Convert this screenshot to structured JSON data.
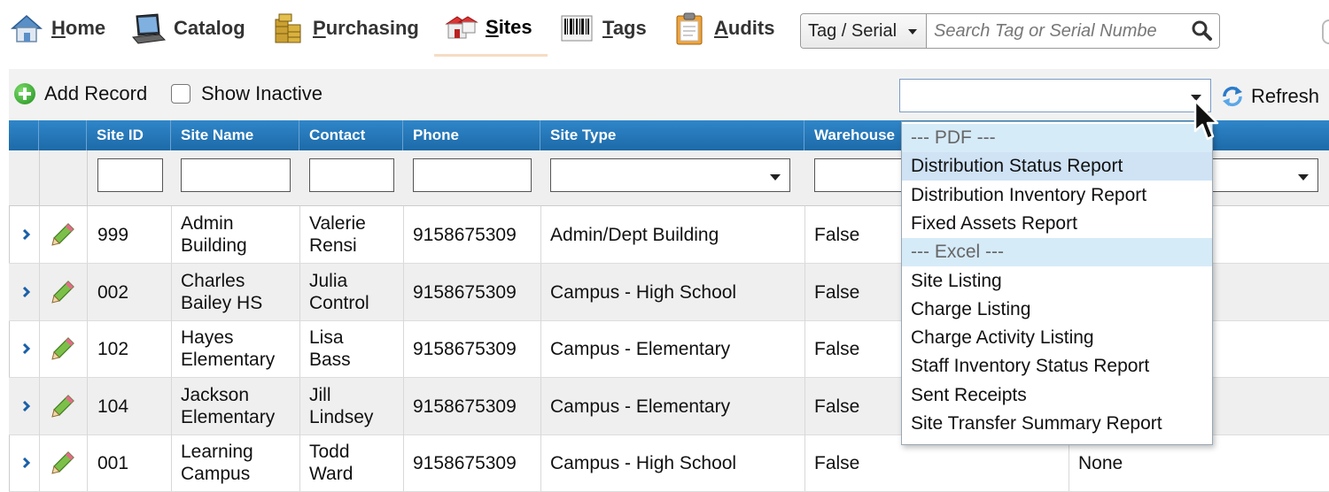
{
  "nav": {
    "items": [
      {
        "label_first": "H",
        "label_rest": "ome",
        "icon": "home-icon"
      },
      {
        "label_first": "",
        "label_rest": "Catalog",
        "icon": "laptop-icon"
      },
      {
        "label_first": "P",
        "label_rest": "urchasing",
        "icon": "coins-icon"
      },
      {
        "label_first": "S",
        "label_rest": "ites",
        "icon": "buildings-icon"
      },
      {
        "label_first": "T",
        "label_rest": "ags",
        "icon": "barcode-icon"
      },
      {
        "label_first": "A",
        "label_rest": "udits",
        "icon": "clipboard-icon"
      }
    ],
    "active": "Sites"
  },
  "search": {
    "type_value": "Tag / Serial",
    "placeholder": "Search Tag or Serial Numbe"
  },
  "toolbar": {
    "add_label": "Add Record",
    "inactive_label": "Show Inactive",
    "refresh_label": "Refresh",
    "report_value": ""
  },
  "grid": {
    "columns": [
      "Site ID",
      "Site Name",
      "Contact",
      "Phone",
      "Site Type",
      "Warehouse"
    ],
    "rows": [
      {
        "site_id": "999",
        "site_name": [
          "Admin",
          "Building"
        ],
        "contact": [
          "Valerie",
          "Rensi"
        ],
        "phone": "9158675309",
        "site_type": "Admin/Dept Building",
        "warehouse": "False",
        "extra": ""
      },
      {
        "site_id": "002",
        "site_name": [
          "Charles",
          "Bailey HS"
        ],
        "contact": [
          "Julia",
          "Control"
        ],
        "phone": "9158675309",
        "site_type": "Campus - High School",
        "warehouse": "False",
        "extra": ""
      },
      {
        "site_id": "102",
        "site_name": [
          "Hayes",
          "Elementary"
        ],
        "contact": [
          "Lisa",
          "Bass"
        ],
        "phone": "9158675309",
        "site_type": "Campus - Elementary",
        "warehouse": "False",
        "extra": ""
      },
      {
        "site_id": "104",
        "site_name": [
          "Jackson",
          "Elementary"
        ],
        "contact": [
          "Jill",
          "Lindsey"
        ],
        "phone": "9158675309",
        "site_type": "Campus - Elementary",
        "warehouse": "False",
        "extra": ""
      },
      {
        "site_id": "001",
        "site_name": [
          "Learning",
          "Campus"
        ],
        "contact": [
          "Todd",
          "Ward"
        ],
        "phone": "9158675309",
        "site_type": "Campus - High School",
        "warehouse": "False",
        "extra": "None"
      }
    ]
  },
  "report_dropdown": {
    "items": [
      {
        "label": "--- PDF ---",
        "kind": "group"
      },
      {
        "label": "Distribution Status Report",
        "kind": "highlighted"
      },
      {
        "label": "Distribution Inventory Report",
        "kind": "item"
      },
      {
        "label": "Fixed Assets Report",
        "kind": "item"
      },
      {
        "label": "--- Excel ---",
        "kind": "group"
      },
      {
        "label": "Site Listing",
        "kind": "item"
      },
      {
        "label": "Charge Listing",
        "kind": "item"
      },
      {
        "label": "Charge Activity Listing",
        "kind": "item"
      },
      {
        "label": "Staff Inventory Status Report",
        "kind": "item"
      },
      {
        "label": "Sent Receipts",
        "kind": "item"
      },
      {
        "label": "Site Transfer Summary Report",
        "kind": "item"
      }
    ]
  },
  "colors": {
    "header_blue": "#1d6aa8",
    "dropdown_group_bg": "#d6ebf8",
    "dropdown_highlight_bg": "#cfe3f5",
    "expander_blue": "#1a5fa8",
    "add_green": "#1f8f1f"
  }
}
